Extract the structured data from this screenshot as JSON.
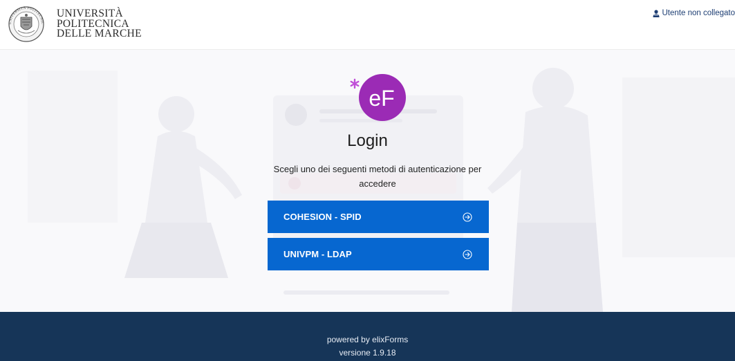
{
  "header": {
    "university_lines": [
      "UNIVERSITÀ",
      "POLITECNICA",
      "DELLE MARCHE"
    ],
    "seal_text": "UNIVERSITÀ POLITECNICA DELLE MARCHE",
    "user_status": "Utente non collegato"
  },
  "login": {
    "logo_text": "eF",
    "title": "Login",
    "subtitle": "Scegli uno dei seguenti metodi di autenticazione per accedere",
    "methods": [
      {
        "label": "COHESION - SPID"
      },
      {
        "label": "UNIVPM - LDAP"
      }
    ]
  },
  "footer": {
    "powered_by": "powered by elixForms",
    "version": "versione 1.9.18"
  },
  "colors": {
    "primary_button": "#0767d0",
    "footer_bg": "#163558",
    "logo_purple": "#9b2bb5"
  },
  "icons": {
    "seal": "university-seal-icon",
    "user": "user-icon",
    "arrow": "arrow-circle-right-icon"
  }
}
